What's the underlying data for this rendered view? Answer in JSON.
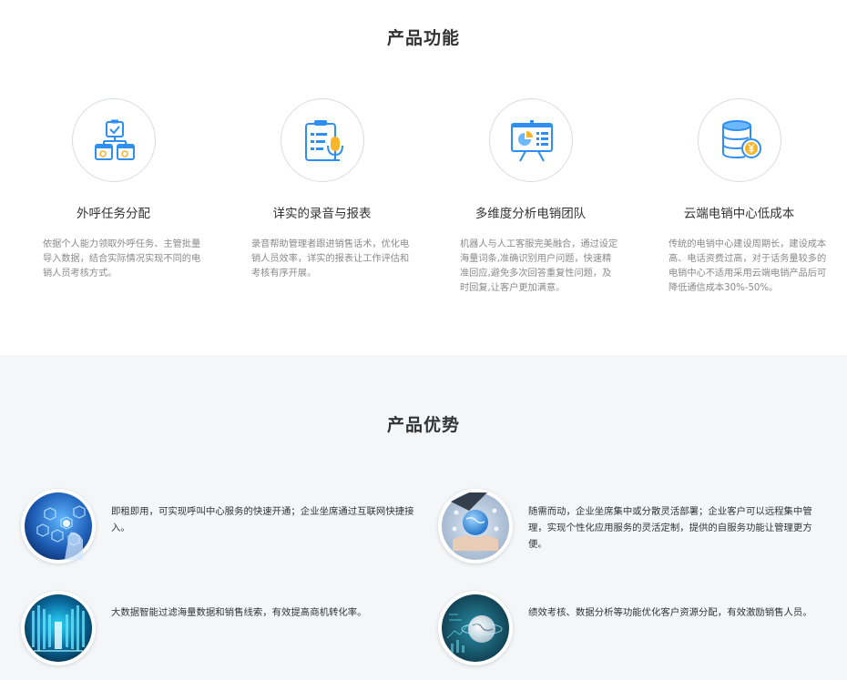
{
  "functions": {
    "title": "产品功能",
    "items": [
      {
        "name": "外呼任务分配",
        "desc": "依据个人能力领取外呼任务、主管批量导入数据，结合实际情况实现不同的电销人员考核方式。",
        "icon": "task-assign-icon"
      },
      {
        "name": "详实的录音与报表",
        "desc": "录音帮助管理者跟进销售话术，优化电销人员效率，详实的报表让工作评估和考核有序开展。",
        "icon": "recording-report-icon"
      },
      {
        "name": "多维度分析电销团队",
        "desc": "机器人与人工客服完美融合，通过设定海量词条,准确识别用户问题，快速精准回应,避免多次回答重复性问题，及时回复,让客户更加满意。",
        "icon": "analysis-board-icon"
      },
      {
        "name": "云端电销中心低成本",
        "desc": "传统的电销中心建设周期长，建设成本高、电话资费过高，对于话务量较多的电销中心不适用采用云端电销产品后可降低通信成本30%-50%。",
        "icon": "database-cost-icon"
      }
    ]
  },
  "advantages": {
    "title": "产品优势",
    "items": [
      {
        "text": "即租即用，可实现呼叫中心服务的快速开通；企业坐席通过互联网快捷接入。",
        "image": "network-touch-image"
      },
      {
        "text": "随需而动，企业坐席集中或分散灵活部署；企业客户可以远程集中管理，实现个性化应用服务的灵活定制，提供的自服务功能让管理更方便。",
        "image": "globe-hands-image"
      },
      {
        "text": "大数据智能过滤海量数据和销售线索，有效提高商机转化率。",
        "image": "data-server-image"
      },
      {
        "text": "绩效考核、数据分析等功能优化客户资源分配，有效激励销售人员。",
        "image": "digital-globe-image"
      }
    ]
  },
  "colors": {
    "accent": "#2f8ff0",
    "accent_light": "#6bb8ff",
    "coin": "#f7b52c",
    "text": "#333333",
    "muted": "#8a8a8a",
    "bg_alt": "#f5f6f8"
  }
}
